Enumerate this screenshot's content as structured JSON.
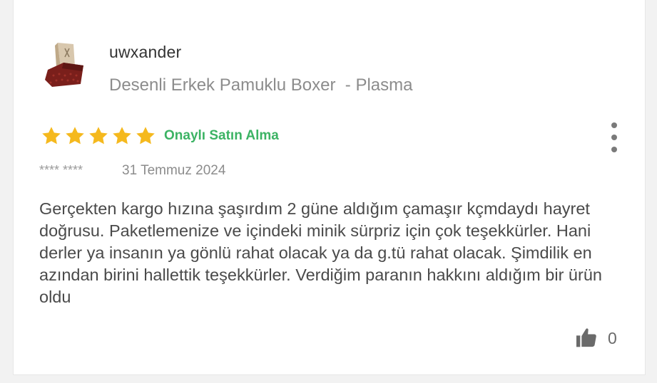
{
  "review": {
    "username": "uwxander",
    "product_name": "Desenli Erkek Pamuklu Boxer  - Plasma",
    "rating": 5,
    "rating_max": 5,
    "verified_label": "Onaylı Satın Alma",
    "reviewer_masked": "**** ****",
    "date": "31 Temmuz 2024",
    "comment": "Gerçekten kargo hızına şaşırdım 2 güne aldığım çamaşır kçmdaydı hayret doğrusu. Paketlemenize ve içindeki minik sürpriz için çok teşekkürler. Hani derler ya insanın ya gönlü rahat olacak ya da g.tü rahat olacak. Şimdilik en azından birini hallettik teşekkürler. Verdiğim paranın hakkını aldığım bir ürün oldu",
    "like_count": "0"
  },
  "icons": {
    "star": "star-icon",
    "more": "more-vertical-icon",
    "like": "thumbs-up-icon"
  },
  "colors": {
    "star": "#f5b91e",
    "verified": "#3cb364",
    "text": "#4a4a4a",
    "muted": "#8c8c8c"
  }
}
